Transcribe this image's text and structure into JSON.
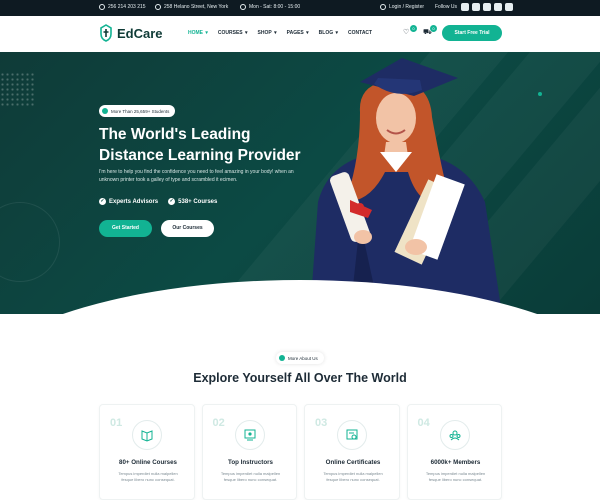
{
  "topbar": {
    "phone": "256 214 203 215",
    "address": "258 Helano Street, New York",
    "hours": "Mon - Sat: 8:00 - 15:00",
    "login": "Login / Register",
    "follow": "Follow Us"
  },
  "header": {
    "logo": "EdCare",
    "nav": [
      {
        "label": "HOME",
        "active": true
      },
      {
        "label": "COURSES"
      },
      {
        "label": "SHOP"
      },
      {
        "label": "PAGES"
      },
      {
        "label": "BLOG"
      },
      {
        "label": "CONTACT"
      }
    ],
    "wishlist_count": "0",
    "cart_count": "0",
    "cta": "Start Free Trial"
  },
  "hero": {
    "pill": "More Than 25,659+ Students",
    "title_line1": "The World's Leading",
    "title_line2": "Distance Learning Provider",
    "description": "I'm here to help you find the confidence you need to feel amazing in your body! when an unknown printer took a galley of type and scrambled it ecimen.",
    "feature1": "Experts Advisors",
    "feature2": "538+ Courses",
    "btn_primary": "Get Started",
    "btn_secondary": "Our Courses"
  },
  "about": {
    "pill": "More About Us",
    "title": "Explore Yourself All Over The World",
    "cards": [
      {
        "num": "01",
        "title": "80+ Online Courses",
        "text": "Tempus imperdiet nulla malpellen fesque libero nunc consequat."
      },
      {
        "num": "02",
        "title": "Top Instructors",
        "text": "Tempus imperdiet nulla malpellen fesque libero nunc consequat."
      },
      {
        "num": "03",
        "title": "Online Certificates",
        "text": "Tempus imperdiet nulla malpellen fesque libero nunc consequat."
      },
      {
        "num": "04",
        "title": "6000k+ Members",
        "text": "Tempus imperdiet nulla malpellen fesque libero nunc consequat."
      }
    ]
  },
  "colors": {
    "accent": "#12b393",
    "hero_bg": "#0c4a44",
    "topbar_bg": "#0e1a22"
  }
}
